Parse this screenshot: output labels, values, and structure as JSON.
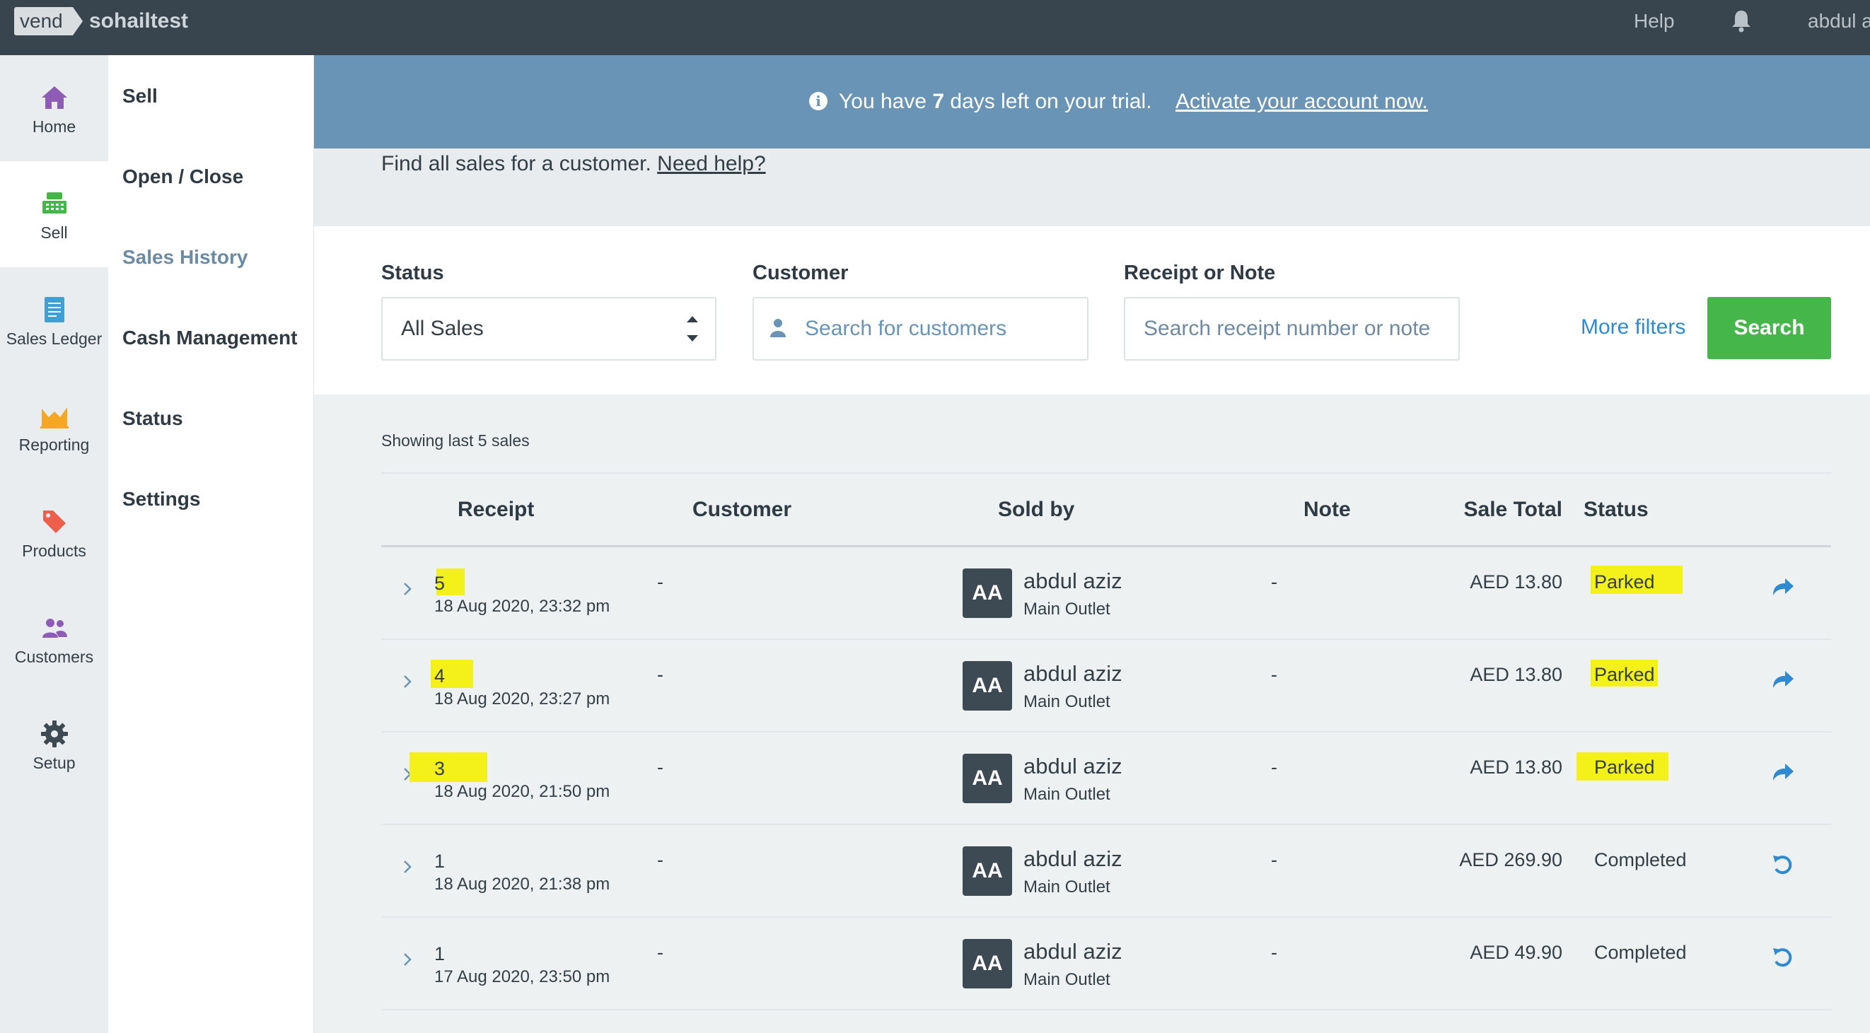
{
  "topbar": {
    "logo": "vend",
    "store_name": "sohailtest",
    "help": "Help",
    "user": "abdul a"
  },
  "rail": [
    {
      "label": "Home",
      "icon": "home-icon",
      "color": "#8e5bb5"
    },
    {
      "label": "Sell",
      "icon": "register-icon",
      "color": "#45b649"
    },
    {
      "label": "Sales Ledger",
      "icon": "ledger-icon",
      "color": "#3fa0d8"
    },
    {
      "label": "Reporting",
      "icon": "chart-icon",
      "color": "#f5a623"
    },
    {
      "label": "Products",
      "icon": "tag-icon",
      "color": "#ec5f4b"
    },
    {
      "label": "Customers",
      "icon": "users-icon",
      "color": "#8e5bb5"
    },
    {
      "label": "Setup",
      "icon": "gear-icon",
      "color": "#3e4a53"
    }
  ],
  "submenu": [
    "Sell",
    "Open / Close",
    "Sales History",
    "Cash Management",
    "Status",
    "Settings"
  ],
  "trial": {
    "prefix": "You have",
    "days": "7",
    "suffix": "days left on your trial.",
    "link": "Activate your account now."
  },
  "find": {
    "text": "Find all sales for a customer.",
    "link": "Need help?"
  },
  "filters": {
    "status_label": "Status",
    "status_value": "All Sales",
    "customer_label": "Customer",
    "customer_placeholder": "Search for customers",
    "receipt_label": "Receipt or Note",
    "receipt_placeholder": "Search receipt number or note",
    "more_filters": "More filters",
    "search_button": "Search"
  },
  "showing": "Showing last 5 sales",
  "table": {
    "headers": [
      "Receipt",
      "Customer",
      "Sold by",
      "Note",
      "Sale Total",
      "Status"
    ],
    "rows": [
      {
        "receipt": "5",
        "date": "18 Aug 2020, 23:32 pm",
        "customer": "-",
        "initials": "AA",
        "seller": "abdul aziz",
        "outlet": "Main Outlet",
        "note": "-",
        "total": "AED 13.80",
        "status": "Parked",
        "action": "resume-icon"
      },
      {
        "receipt": "4",
        "date": "18 Aug 2020, 23:27 pm",
        "customer": "-",
        "initials": "AA",
        "seller": "abdul aziz",
        "outlet": "Main Outlet",
        "note": "-",
        "total": "AED 13.80",
        "status": "Parked",
        "action": "resume-icon"
      },
      {
        "receipt": "3",
        "date": "18 Aug 2020, 21:50 pm",
        "customer": "-",
        "initials": "AA",
        "seller": "abdul aziz",
        "outlet": "Main Outlet",
        "note": "-",
        "total": "AED 13.80",
        "status": "Parked",
        "action": "resume-icon"
      },
      {
        "receipt": "1",
        "date": "18 Aug 2020, 21:38 pm",
        "customer": "-",
        "initials": "AA",
        "seller": "abdul aziz",
        "outlet": "Main Outlet",
        "note": "-",
        "total": "AED 269.90",
        "status": "Completed",
        "action": "return-icon"
      },
      {
        "receipt": "1",
        "date": "17 Aug 2020, 23:50 pm",
        "customer": "-",
        "initials": "AA",
        "seller": "abdul aziz",
        "outlet": "Main Outlet",
        "note": "-",
        "total": "AED 49.90",
        "status": "Completed",
        "action": "return-icon"
      }
    ]
  },
  "colors": {
    "topbar": "#38454f",
    "trial_banner": "#6994b5",
    "accent_blue": "#2e8ad1",
    "search_green": "#45b649",
    "highlight": "#f3f01a"
  }
}
